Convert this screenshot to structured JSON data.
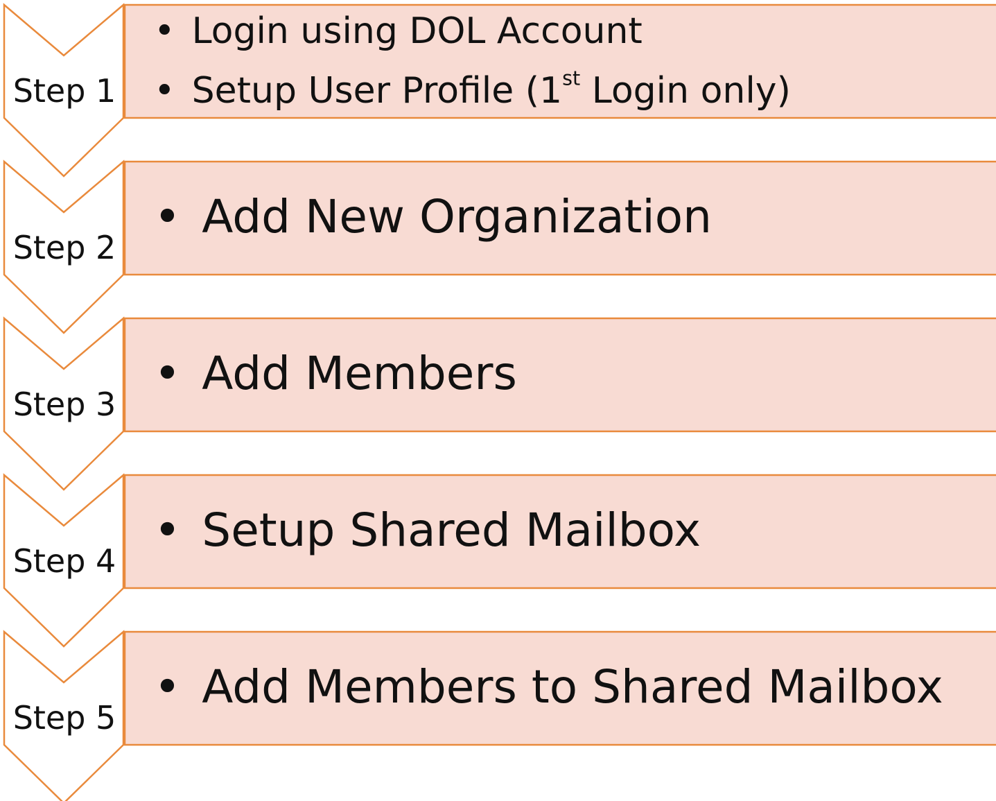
{
  "colors": {
    "box_fill": "#f8dbd3",
    "box_border": "#e98a3c",
    "chevron_fill": "#ffffff",
    "chevron_border": "#e98a3c",
    "text": "#111111"
  },
  "steps": [
    {
      "label": "Step 1",
      "items": [
        {
          "text": "Login using DOL Account"
        },
        {
          "text_before": "Setup User Profile (1",
          "sup": "st",
          "text_after": " Login only)"
        }
      ]
    },
    {
      "label": "Step 2",
      "items": [
        {
          "text": "Add New Organization"
        }
      ]
    },
    {
      "label": "Step 3",
      "items": [
        {
          "text": "Add Members"
        }
      ]
    },
    {
      "label": "Step 4",
      "items": [
        {
          "text": "Setup Shared Mailbox"
        }
      ]
    },
    {
      "label": "Step 5",
      "items": [
        {
          "text": "Add Members to Shared Mailbox"
        }
      ]
    }
  ]
}
